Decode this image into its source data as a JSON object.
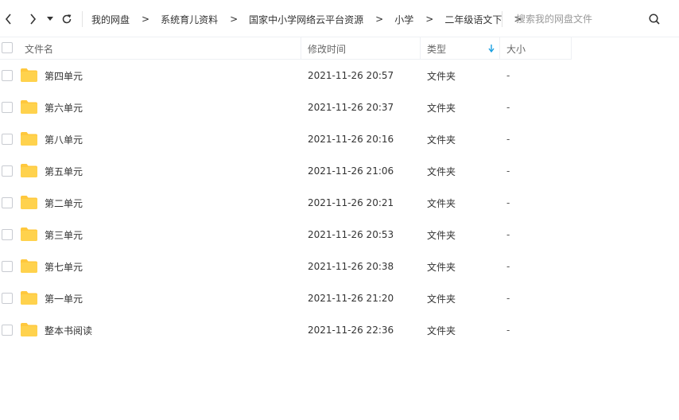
{
  "toolbar": {
    "back_icon": "chevron-left-icon",
    "forward_icon": "chevron-right-icon",
    "history_icon": "caret-down-icon",
    "refresh_icon": "refresh-icon"
  },
  "breadcrumb": {
    "items": [
      "我的网盘",
      "系统育儿资料",
      "国家中小学网络云平台资源",
      "小学",
      "二年级语文下"
    ],
    "separator": ">"
  },
  "search": {
    "placeholder": "搜索我的网盘文件",
    "icon": "search-icon"
  },
  "table": {
    "headers": {
      "name": "文件名",
      "modified": "修改时间",
      "type": "类型",
      "size": "大小"
    },
    "sort_column": "type",
    "sort_direction": "descending",
    "rows": [
      {
        "name": "第四单元",
        "modified": "2021-11-26 20:57",
        "type": "文件夹",
        "size": "-"
      },
      {
        "name": "第六单元",
        "modified": "2021-11-26 20:37",
        "type": "文件夹",
        "size": "-"
      },
      {
        "name": "第八单元",
        "modified": "2021-11-26 20:16",
        "type": "文件夹",
        "size": "-"
      },
      {
        "name": "第五单元",
        "modified": "2021-11-26 21:06",
        "type": "文件夹",
        "size": "-"
      },
      {
        "name": "第二单元",
        "modified": "2021-11-26 20:21",
        "type": "文件夹",
        "size": "-"
      },
      {
        "name": "第三单元",
        "modified": "2021-11-26 20:53",
        "type": "文件夹",
        "size": "-"
      },
      {
        "name": "第七单元",
        "modified": "2021-11-26 20:38",
        "type": "文件夹",
        "size": "-"
      },
      {
        "name": "第一单元",
        "modified": "2021-11-26 21:20",
        "type": "文件夹",
        "size": "-"
      },
      {
        "name": "整本书阅读",
        "modified": "2021-11-26 22:36",
        "type": "文件夹",
        "size": "-"
      }
    ]
  },
  "colors": {
    "folder": "#FFC83D",
    "sort_arrow": "#1A9FE0",
    "divider": "#EEF0F4"
  }
}
